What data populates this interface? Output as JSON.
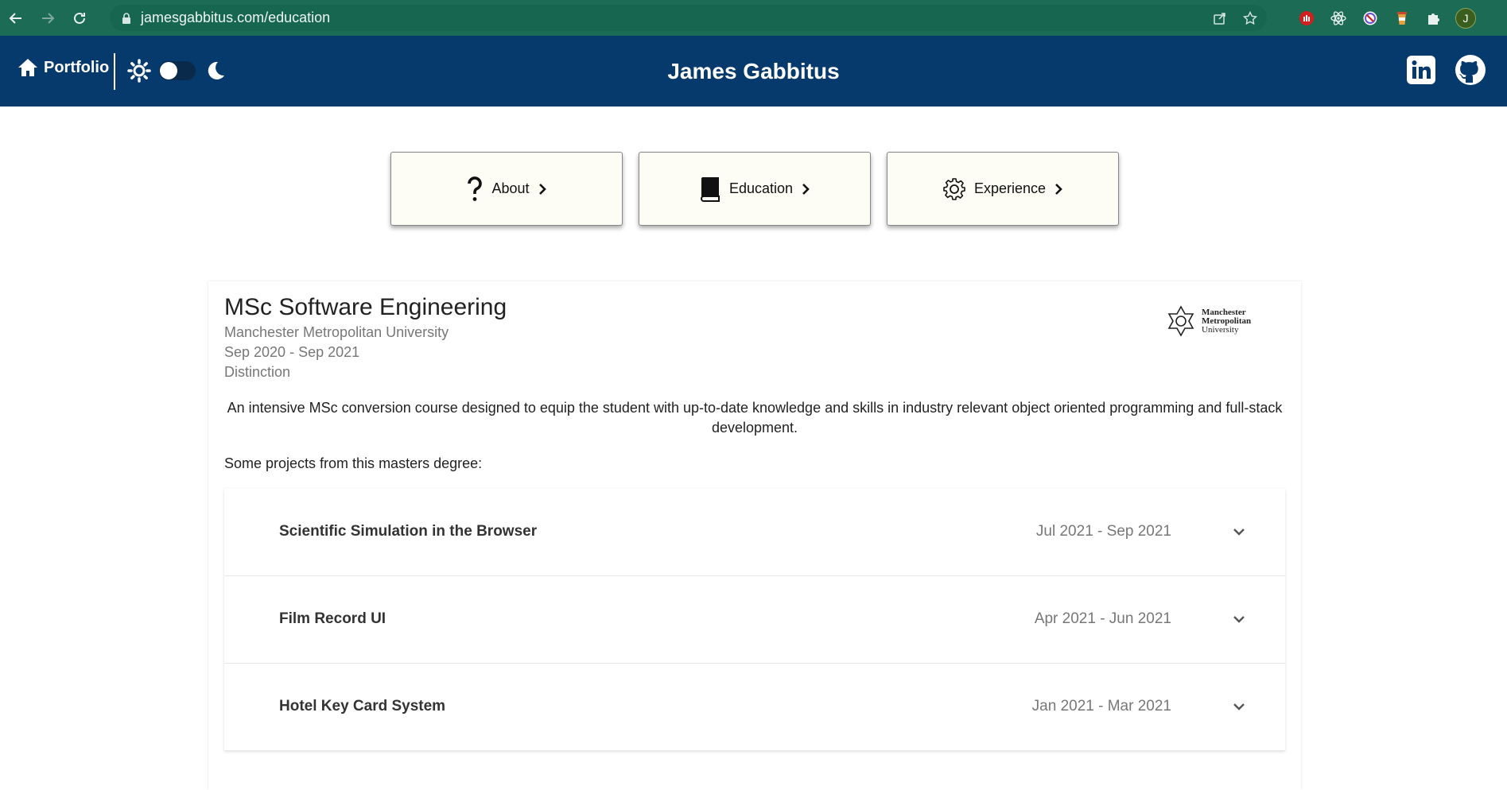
{
  "browser": {
    "url": "jamesgabbitus.com/education",
    "profile_initial": "J"
  },
  "header": {
    "home_label": "Portfolio",
    "site_title": "James Gabbitus",
    "social": [
      "linkedin-icon",
      "github-icon"
    ],
    "colors": {
      "bar": "#063a6c",
      "browser": "#1b6b55"
    }
  },
  "section_nav": [
    {
      "label": "About",
      "icon": "question-mark-icon"
    },
    {
      "label": "Education",
      "icon": "book-icon"
    },
    {
      "label": "Experience",
      "icon": "gear-icon"
    }
  ],
  "education": {
    "degree": "MSc Software Engineering",
    "university": "Manchester Metropolitan University",
    "dates": "Sep 2020 - Sep 2021",
    "grade": "Distinction",
    "logo_text": [
      "Manchester",
      "Metropolitan",
      "University"
    ],
    "description": "An intensive MSc conversion course designed to equip the student with up-to-date knowledge and skills in industry relevant object oriented programming and full-stack development.",
    "projects_intro": "Some projects from this masters degree:",
    "projects": [
      {
        "title": "Scientific Simulation in the Browser",
        "dates": "Jul 2021 - Sep 2021"
      },
      {
        "title": "Film Record UI",
        "dates": "Apr 2021 - Jun 2021"
      },
      {
        "title": "Hotel Key Card System",
        "dates": "Jan 2021 - Mar 2021"
      }
    ]
  }
}
